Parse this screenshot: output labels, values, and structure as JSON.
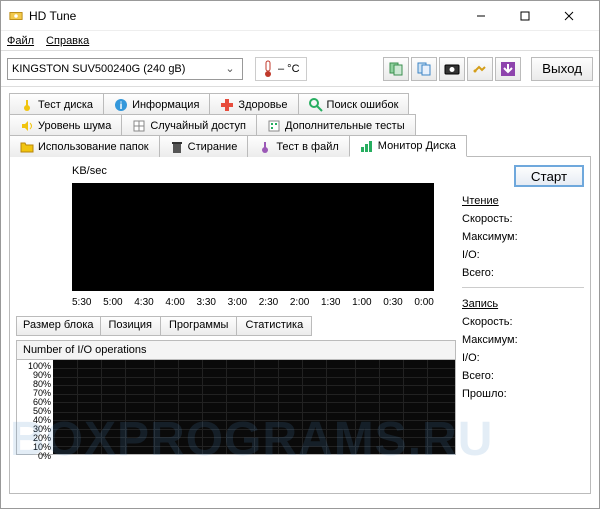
{
  "window": {
    "title": "HD Tune"
  },
  "menu": {
    "file": "Файл",
    "help": "Справка"
  },
  "toolbar": {
    "drive": "KINGSTON SUV500240G (240 gB)",
    "temp": "– °C",
    "exit": "Выход"
  },
  "tabs": {
    "test_disk": "Тест диска",
    "info": "Информация",
    "health": "Здоровье",
    "error_scan": "Поиск ошибок",
    "noise": "Уровень шума",
    "random_access": "Случайный доступ",
    "extra_tests": "Дополнительные тесты",
    "folder_usage": "Использование папок",
    "erase": "Стирание",
    "file_test": "Тест в файл",
    "disk_monitor": "Монитор Диска"
  },
  "monitor": {
    "kbsec": "KB/sec",
    "xaxis": [
      "5:30",
      "5:00",
      "4:30",
      "4:00",
      "3:30",
      "3:00",
      "2:30",
      "2:00",
      "1:30",
      "1:00",
      "0:30",
      "0:00"
    ],
    "block_size": "Размер блока",
    "subtabs": {
      "position": "Позиция",
      "programs": "Программы",
      "stats": "Статистика"
    },
    "iops_title": "Number of I/O operations",
    "yaxis2": [
      "100%",
      "90%",
      "80%",
      "70%",
      "60%",
      "50%",
      "40%",
      "30%",
      "20%",
      "10%",
      "0%"
    ],
    "start": "Старт",
    "read": "Чтение",
    "write": "Запись",
    "speed": "Скорость:",
    "max": "Максимум:",
    "io": "I/O:",
    "total": "Всего:",
    "elapsed": "Прошло:"
  },
  "watermark": "BOXPROGRAMS.RU"
}
